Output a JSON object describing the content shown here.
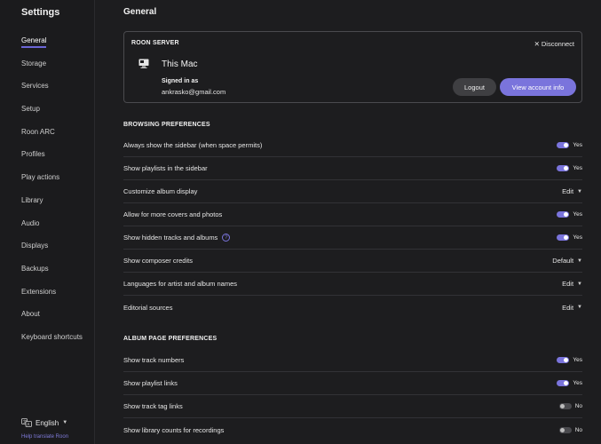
{
  "app": {
    "title": "Settings"
  },
  "sidebar": {
    "items": [
      {
        "label": "General",
        "active": true
      },
      {
        "label": "Storage"
      },
      {
        "label": "Services"
      },
      {
        "label": "Setup"
      },
      {
        "label": "Roon ARC"
      },
      {
        "label": "Profiles"
      },
      {
        "label": "Play actions"
      },
      {
        "label": "Library"
      },
      {
        "label": "Audio"
      },
      {
        "label": "Displays"
      },
      {
        "label": "Backups"
      },
      {
        "label": "Extensions"
      },
      {
        "label": "About"
      },
      {
        "label": "Keyboard shortcuts"
      }
    ],
    "language": "English",
    "help_link": "Help translate Roon"
  },
  "page": {
    "title": "General"
  },
  "server": {
    "heading": "ROON SERVER",
    "disconnect": "Disconnect",
    "name": "This Mac",
    "signed_in_label": "Signed in as",
    "email": "ankrasko@gmail.com",
    "logout": "Logout",
    "view_account": "View account info"
  },
  "browsing": {
    "heading": "BROWSING PREFERENCES",
    "rows": [
      {
        "label": "Always show the sidebar (when space permits)",
        "value": "Yes"
      },
      {
        "label": "Show playlists in the sidebar",
        "value": "Yes"
      },
      {
        "label": "Customize album display",
        "value": "Edit"
      },
      {
        "label": "Allow for more covers and photos",
        "value": "Yes"
      },
      {
        "label": "Show hidden tracks and albums",
        "value": "Yes"
      },
      {
        "label": "Show composer credits",
        "value": "Default"
      },
      {
        "label": "Languages for artist and album names",
        "value": "Edit"
      },
      {
        "label": "Editorial sources",
        "value": "Edit"
      }
    ]
  },
  "album": {
    "heading": "ALBUM PAGE PREFERENCES",
    "rows": [
      {
        "label": "Show track numbers",
        "value": "Yes"
      },
      {
        "label": "Show playlist links",
        "value": "Yes"
      },
      {
        "label": "Show track tag links",
        "value": "No"
      },
      {
        "label": "Show library counts for recordings",
        "value": "No"
      }
    ]
  },
  "colors": {
    "accent": "#7a74dc",
    "background": "#1d1d1f",
    "toggle_off": "#4a4a4e"
  },
  "icons": {
    "server": "mac-computer-icon",
    "disconnect": "close-icon",
    "language": "translate-icon",
    "help": "help-circle-icon",
    "dropdown": "caret-down-icon"
  }
}
